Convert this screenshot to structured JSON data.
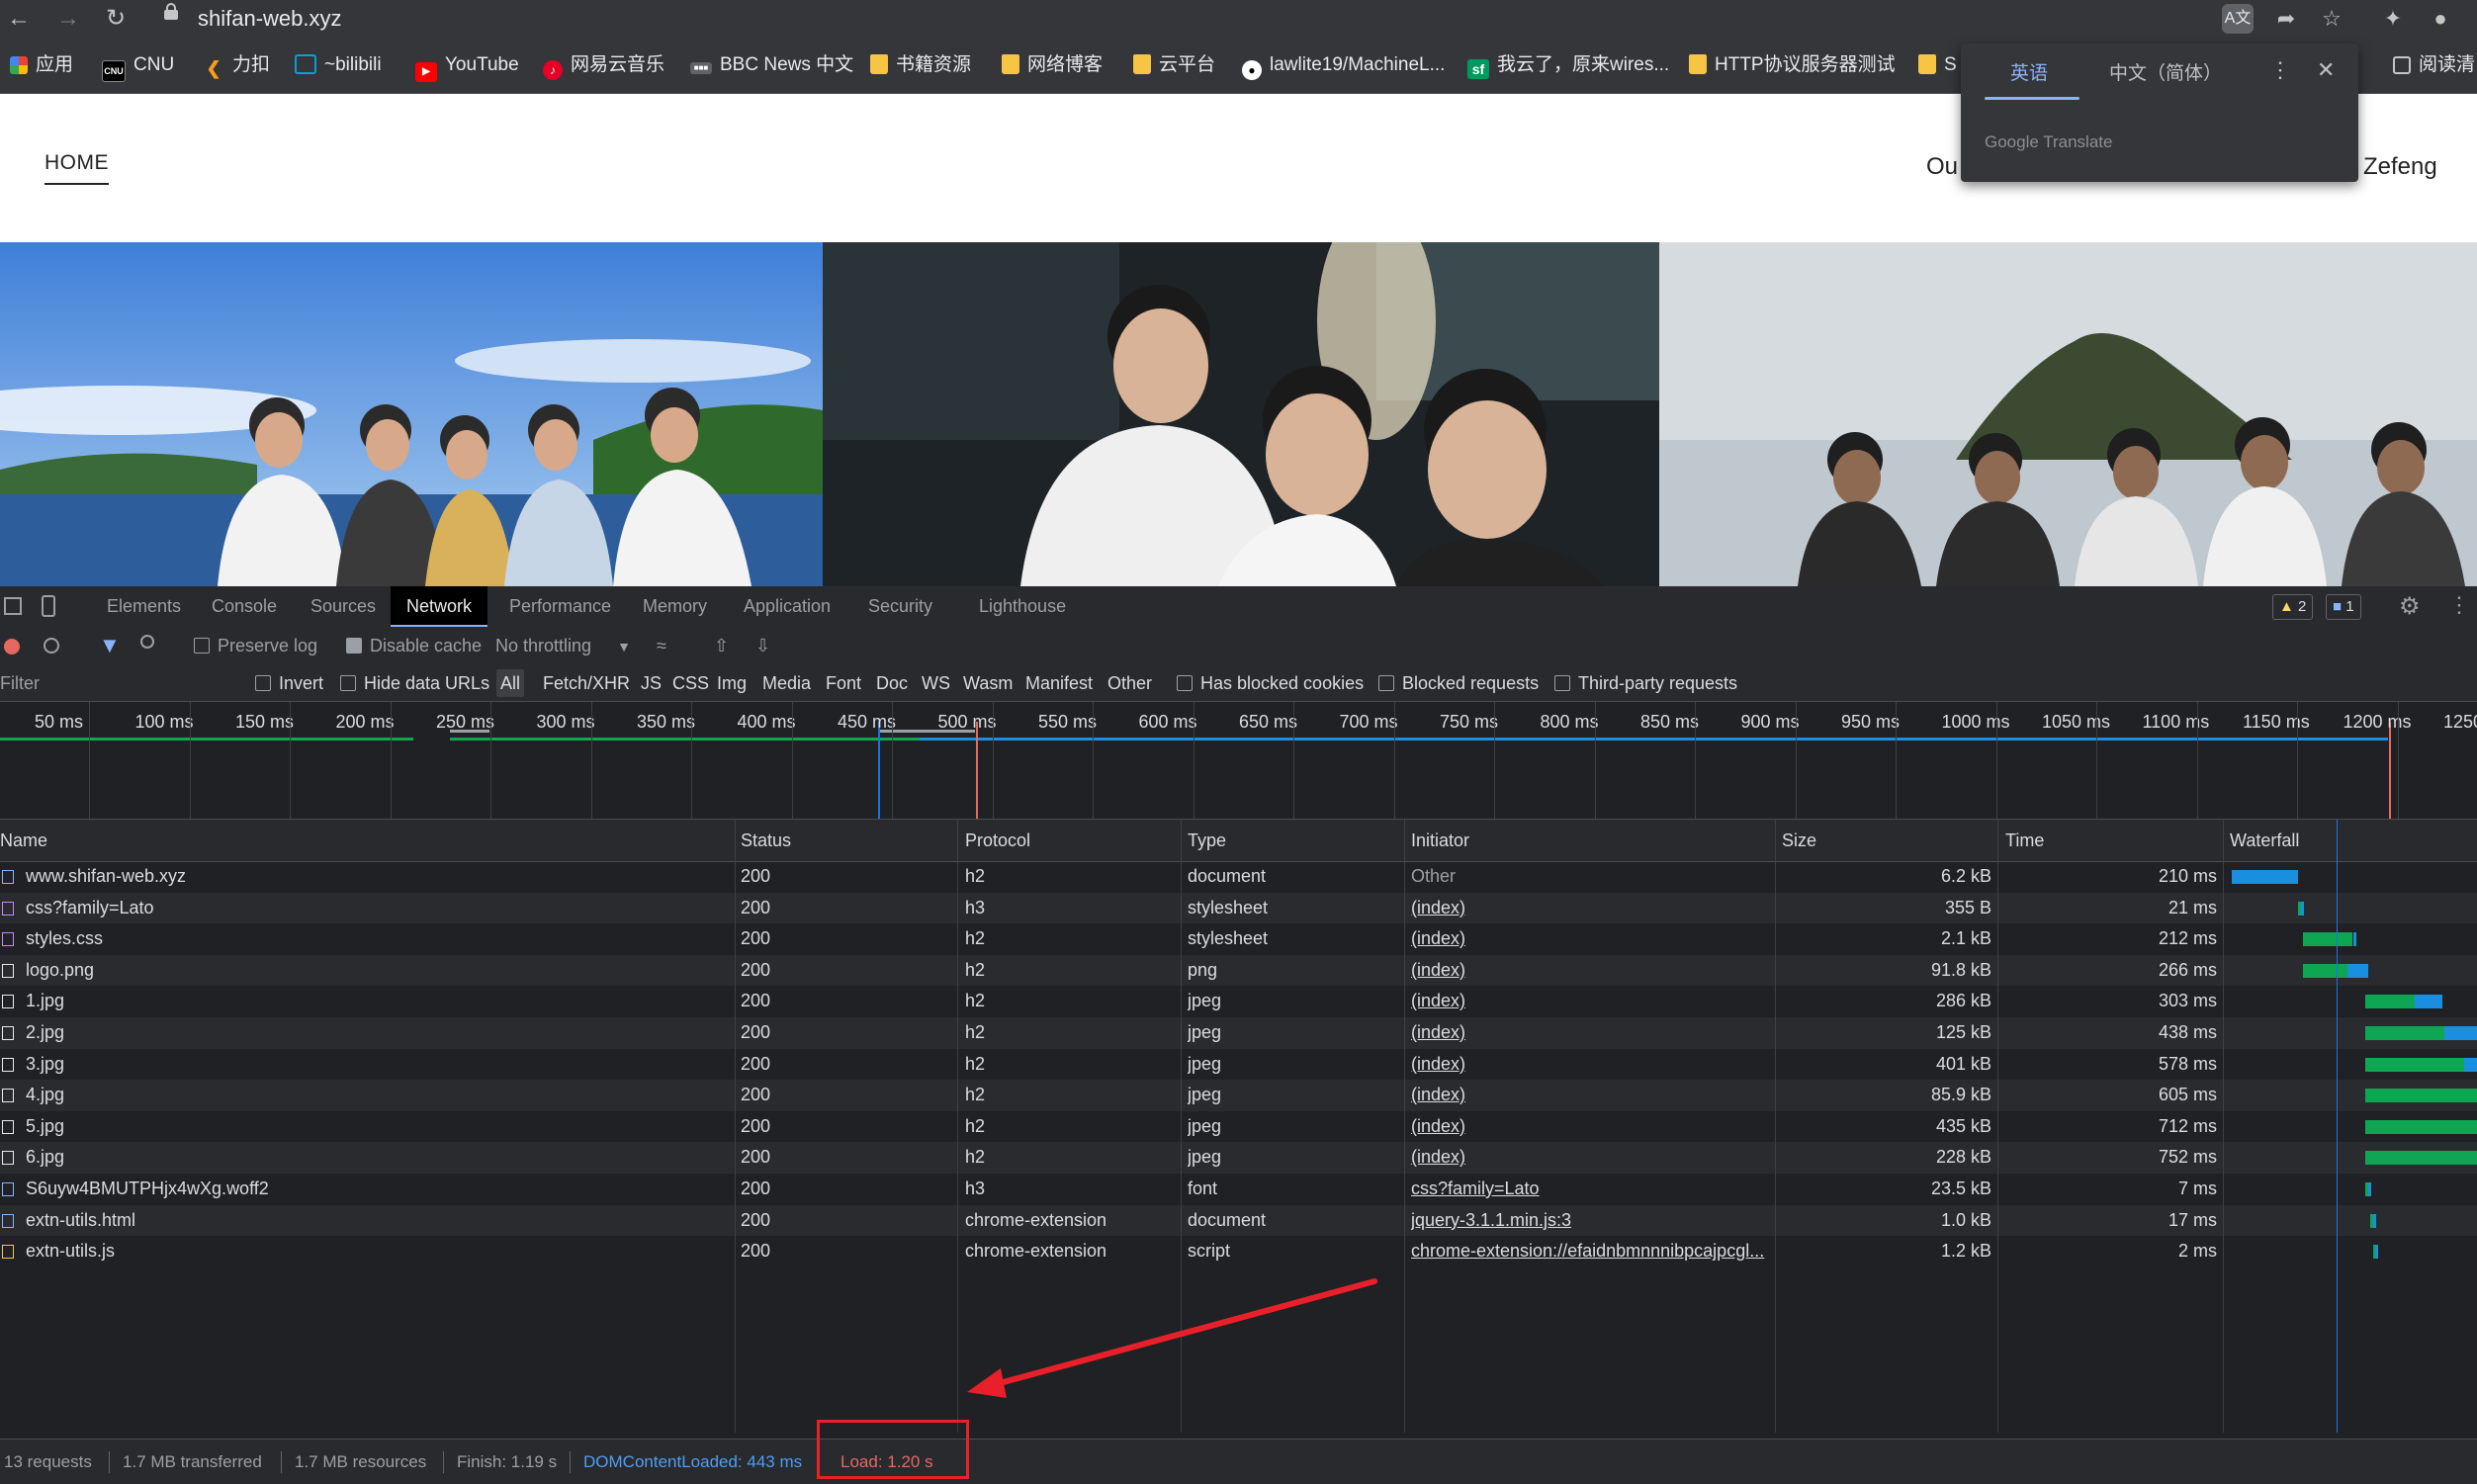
{
  "browser": {
    "url": "shifan-web.xyz",
    "bookmarks": [
      {
        "label": "应用",
        "icon": "apps-grid-icon",
        "color": "#ea4335"
      },
      {
        "label": "CNU",
        "icon": "cnu-logo-icon",
        "color": "#000000"
      },
      {
        "label": "力扣",
        "icon": "leetcode-icon",
        "color": "#f89f1b"
      },
      {
        "label": "~bilibili",
        "icon": "bilibili-icon",
        "color": "#00a1d6"
      },
      {
        "label": "YouTube",
        "icon": "youtube-icon",
        "color": "#ff0000"
      },
      {
        "label": "网易云音乐",
        "icon": "netease-music-icon",
        "color": "#e60026"
      },
      {
        "label": "BBC News 中文",
        "icon": "bbc-icon",
        "color": "#5f6368"
      },
      {
        "label": "书籍资源",
        "icon": "folder-icon",
        "color": "#f6c544"
      },
      {
        "label": "网络博客",
        "icon": "folder-icon",
        "color": "#f6c544"
      },
      {
        "label": "云平台",
        "icon": "folder-icon",
        "color": "#f6c544"
      },
      {
        "label": "lawlite19/MachineL...",
        "icon": "github-icon",
        "color": "#ffffff"
      },
      {
        "label": "我云了，原来wires...",
        "icon": "segmentfault-icon",
        "color": "#009a61"
      },
      {
        "label": "HTTP协议服务器测试",
        "icon": "folder-icon",
        "color": "#f6c544"
      },
      {
        "label": "S",
        "icon": "folder-icon",
        "color": "#f6c544"
      }
    ],
    "reading_list": "阅读清"
  },
  "translate_popup": {
    "tab_source": "英语",
    "tab_target": "中文（简体）",
    "brand": "Google Translate"
  },
  "page": {
    "home": "HOME",
    "nav_partial_left": "Ou",
    "nav_partial_right": "Zefeng"
  },
  "devtools": {
    "tabs": [
      "Elements",
      "Console",
      "Sources",
      "Network",
      "Performance",
      "Memory",
      "Application",
      "Security",
      "Lighthouse"
    ],
    "active_tab": "Network",
    "warnings_count": "2",
    "messages_count": "1",
    "toolbar": {
      "preserve_log": "Preserve log",
      "disable_cache": "Disable cache",
      "throttling": "No throttling"
    },
    "filter": {
      "placeholder": "Filter",
      "invert": "Invert",
      "hide_data_urls": "Hide data URLs",
      "types": [
        "All",
        "Fetch/XHR",
        "JS",
        "CSS",
        "Img",
        "Media",
        "Font",
        "Doc",
        "WS",
        "Wasm",
        "Manifest",
        "Other"
      ],
      "has_blocked_cookies": "Has blocked cookies",
      "blocked_requests": "Blocked requests",
      "third_party": "Third-party requests"
    },
    "timeline_ticks": [
      "50 ms",
      "100 ms",
      "150 ms",
      "200 ms",
      "250 ms",
      "300 ms",
      "350 ms",
      "400 ms",
      "450 ms",
      "500 ms",
      "550 ms",
      "600 ms",
      "650 ms",
      "700 ms",
      "750 ms",
      "800 ms",
      "850 ms",
      "900 ms",
      "950 ms",
      "1000 ms",
      "1050 ms",
      "1100 ms",
      "1150 ms",
      "1200 ms",
      "1250 ms"
    ],
    "columns": [
      "Name",
      "Status",
      "Protocol",
      "Type",
      "Initiator",
      "Size",
      "Time",
      "Waterfall"
    ],
    "requests": [
      {
        "name": "www.shifan-web.xyz",
        "status": "200",
        "protocol": "h2",
        "type": "document",
        "initiator": "Other",
        "size": "6.2 kB",
        "time": "210 ms",
        "icon": "document-icon",
        "icon_color": "#8ab4f8",
        "wf_start": 0.01,
        "wf_ttfb": 0.0,
        "wf_end": 0.28
      },
      {
        "name": "css?family=Lato",
        "status": "200",
        "protocol": "h3",
        "type": "stylesheet",
        "initiator": "(index)",
        "size": "355 B",
        "time": "21 ms",
        "icon": "stylesheet-icon",
        "icon_color": "#c58af9",
        "wf_start": 0.28,
        "wf_ttfb": 0.29,
        "wf_end": 0.3
      },
      {
        "name": "styles.css",
        "status": "200",
        "protocol": "h2",
        "type": "stylesheet",
        "initiator": "(index)",
        "size": "2.1 kB",
        "time": "212 ms",
        "icon": "stylesheet-icon",
        "icon_color": "#c58af9",
        "wf_start": 0.3,
        "wf_ttfb": 0.5,
        "wf_end": 0.51
      },
      {
        "name": "logo.png",
        "status": "200",
        "protocol": "h2",
        "type": "png",
        "initiator": "(index)",
        "size": "91.8 kB",
        "time": "266 ms",
        "icon": "image-icon",
        "icon_color": "#e8eaed",
        "wf_start": 0.3,
        "wf_ttfb": 0.48,
        "wf_end": 0.56
      },
      {
        "name": "1.jpg",
        "status": "200",
        "protocol": "h2",
        "type": "jpeg",
        "initiator": "(index)",
        "size": "286 kB",
        "time": "303 ms",
        "icon": "image-icon",
        "icon_color": "#e8eaed",
        "wf_start": 0.55,
        "wf_ttfb": 0.75,
        "wf_end": 0.86
      },
      {
        "name": "2.jpg",
        "status": "200",
        "protocol": "h2",
        "type": "jpeg",
        "initiator": "(index)",
        "size": "125 kB",
        "time": "438 ms",
        "icon": "image-icon",
        "icon_color": "#e8eaed",
        "wf_start": 0.55,
        "wf_ttfb": 0.87,
        "wf_end": 1.0
      },
      {
        "name": "3.jpg",
        "status": "200",
        "protocol": "h2",
        "type": "jpeg",
        "initiator": "(index)",
        "size": "401 kB",
        "time": "578 ms",
        "icon": "image-icon",
        "icon_color": "#e8eaed",
        "wf_start": 0.55,
        "wf_ttfb": 0.95,
        "wf_end": 1.0
      },
      {
        "name": "4.jpg",
        "status": "200",
        "protocol": "h2",
        "type": "jpeg",
        "initiator": "(index)",
        "size": "85.9 kB",
        "time": "605 ms",
        "icon": "image-icon",
        "icon_color": "#e8eaed",
        "wf_start": 0.55,
        "wf_ttfb": 1.0,
        "wf_end": 1.0
      },
      {
        "name": "5.jpg",
        "status": "200",
        "protocol": "h2",
        "type": "jpeg",
        "initiator": "(index)",
        "size": "435 kB",
        "time": "712 ms",
        "icon": "image-icon",
        "icon_color": "#e8eaed",
        "wf_start": 0.55,
        "wf_ttfb": 1.0,
        "wf_end": 1.0
      },
      {
        "name": "6.jpg",
        "status": "200",
        "protocol": "h2",
        "type": "jpeg",
        "initiator": "(index)",
        "size": "228 kB",
        "time": "752 ms",
        "icon": "image-icon",
        "icon_color": "#e8eaed",
        "wf_start": 0.55,
        "wf_ttfb": 1.0,
        "wf_end": 1.0
      },
      {
        "name": "S6uyw4BMUTPHjx4wXg.woff2",
        "status": "200",
        "protocol": "h3",
        "type": "font",
        "initiator": "css?family=Lato",
        "size": "23.5 kB",
        "time": "7 ms",
        "icon": "font-icon",
        "icon_color": "#8ab4f8",
        "wf_start": 0.55,
        "wf_ttfb": 0.56,
        "wf_end": 0.56
      },
      {
        "name": "extn-utils.html",
        "status": "200",
        "protocol": "chrome-extension",
        "type": "document",
        "initiator": "jquery-3.1.1.min.js:3",
        "size": "1.0 kB",
        "time": "17 ms",
        "icon": "document-icon",
        "icon_color": "#8ab4f8",
        "wf_start": 0.57,
        "wf_ttfb": 0.58,
        "wf_end": 0.58
      },
      {
        "name": "extn-utils.js",
        "status": "200",
        "protocol": "chrome-extension",
        "type": "script",
        "initiator": "chrome-extension://efaidnbmnnnibpcajpcgl...",
        "size": "1.2 kB",
        "time": "2 ms",
        "icon": "script-icon",
        "icon_color": "#f6c544",
        "wf_start": 0.58,
        "wf_ttfb": 0.59,
        "wf_end": 0.59
      }
    ],
    "summary": {
      "requests": "13 requests",
      "transferred": "1.7 MB transferred",
      "resources": "1.7 MB resources",
      "finish": "Finish: 1.19 s",
      "dom_content_loaded": "DOMContentLoaded: 443 ms",
      "load": "Load: 1.20 s"
    }
  },
  "colors": {
    "annotation_red": "#e8202a",
    "dcl_blue": "#1a73e8",
    "load_red": "#e46962",
    "waterfall_green": "#0fa653",
    "waterfall_blue": "#1a8fe0"
  }
}
